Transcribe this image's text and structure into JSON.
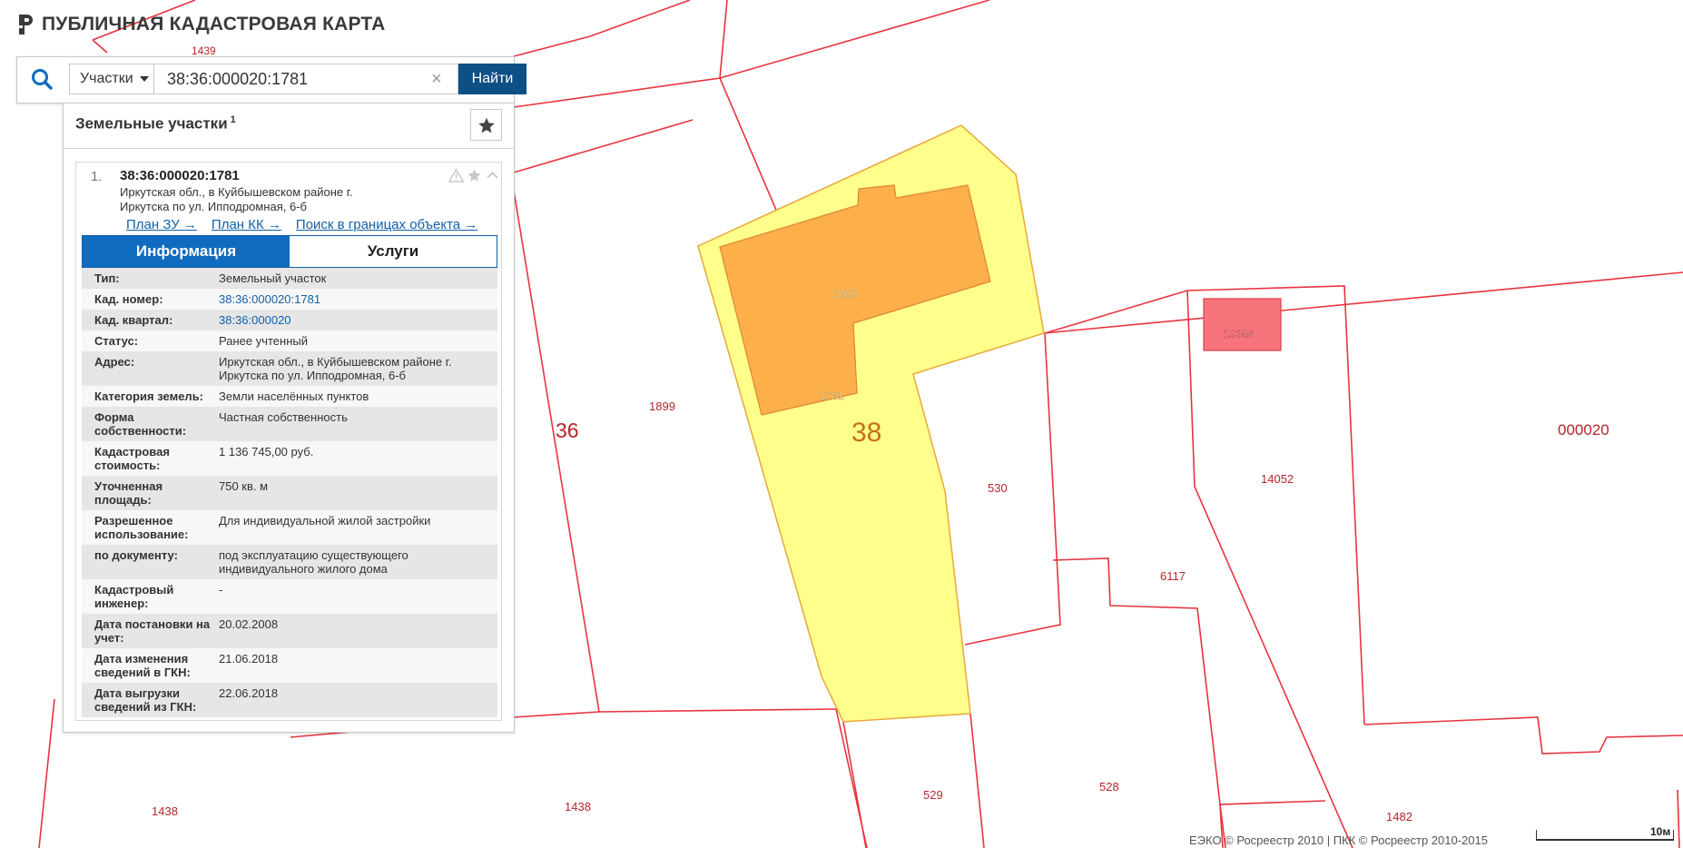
{
  "header": {
    "app_title": "ПУБЛИЧНАЯ КАДАСТРОВАЯ КАРТА"
  },
  "search": {
    "type_selected": "Участки",
    "query": "38:36:000020:1781",
    "find_label": "Найти",
    "clear_symbol": "×"
  },
  "panel": {
    "title": "Земельные участки",
    "count": "1",
    "result": {
      "index": "1.",
      "number": "38:36:000020:1781",
      "address": "Иркутская обл., в Куйбышевском районе г. Иркутска по ул. Ипподромная, 6-б",
      "links": [
        {
          "label": "План ЗУ →"
        },
        {
          "label": "План КК →"
        },
        {
          "label": "Поиск в границах объекта →"
        }
      ],
      "tabs": [
        {
          "label": "Информация",
          "active": true
        },
        {
          "label": "Услуги",
          "active": false
        }
      ],
      "rows": [
        {
          "label": "Тип:",
          "value": "Земельный участок"
        },
        {
          "label": "Кад. номер:",
          "value": "38:36:000020:1781",
          "link": true
        },
        {
          "label": "Кад. квартал:",
          "value": "38:36:000020",
          "link": true
        },
        {
          "label": "Статус:",
          "value": "Ранее учтенный"
        },
        {
          "label": "Адрес:",
          "value": "Иркутская обл., в Куйбышевском районе г. Иркутска по ул. Ипподромная, 6-б"
        },
        {
          "label": "Категория земель:",
          "value": "Земли населённых пунктов"
        },
        {
          "label": "Форма собственности:",
          "value": "Частная собственность"
        },
        {
          "label": "Кадастровая стоимость:",
          "value": "1 136 745,00 руб."
        },
        {
          "label": "Уточненная площадь:",
          "value": "750 кв. м"
        },
        {
          "label": "Разрешенное использование:",
          "value": "Для индивидуальной жилой застройки"
        },
        {
          "label": "по документу:",
          "value": "под эксплуатацию существующего индивидуального жилого дома"
        },
        {
          "label": "Кадастровый инженер:",
          "value": "-"
        },
        {
          "label": "Дата постановки на учет:",
          "value": "20.02.2008"
        },
        {
          "label": "Дата изменения сведений в ГКН:",
          "value": "21.06.2018"
        },
        {
          "label": "Дата выгрузки сведений из ГКН:",
          "value": "22.06.2018"
        }
      ]
    }
  },
  "map": {
    "labels": {
      "l1439": "1439",
      "l1899": "1899",
      "l36": "36",
      "l38": "38",
      "l2655": "2655",
      "l1781": "1781",
      "l19346": "19346",
      "l530": "530",
      "l14052": "14052",
      "l000020": "000020",
      "l6117": "6117",
      "l1438a": "1438",
      "l1438b": "1438",
      "l529": "529",
      "l528": "528",
      "l1482": "1482"
    },
    "colors": {
      "boundary": "#e8343e",
      "selected_fill": "#ffff8c",
      "building_fill": "#fdb04a",
      "highlight_fill": "#f7747c",
      "label": "#b5262b"
    }
  },
  "footer": {
    "attribution": "ЕЭКО © Росреестр 2010 | ПКК © Росреестр 2010-2015",
    "scale_label": "10м"
  },
  "icons": {
    "logo": "pkk-logo-icon",
    "search": "search-icon",
    "caret": "chevron-down-icon",
    "clear": "close-icon",
    "favorite": "star-icon",
    "warning": "warning-icon",
    "star": "star-icon",
    "collapse": "chevron-up-icon"
  }
}
